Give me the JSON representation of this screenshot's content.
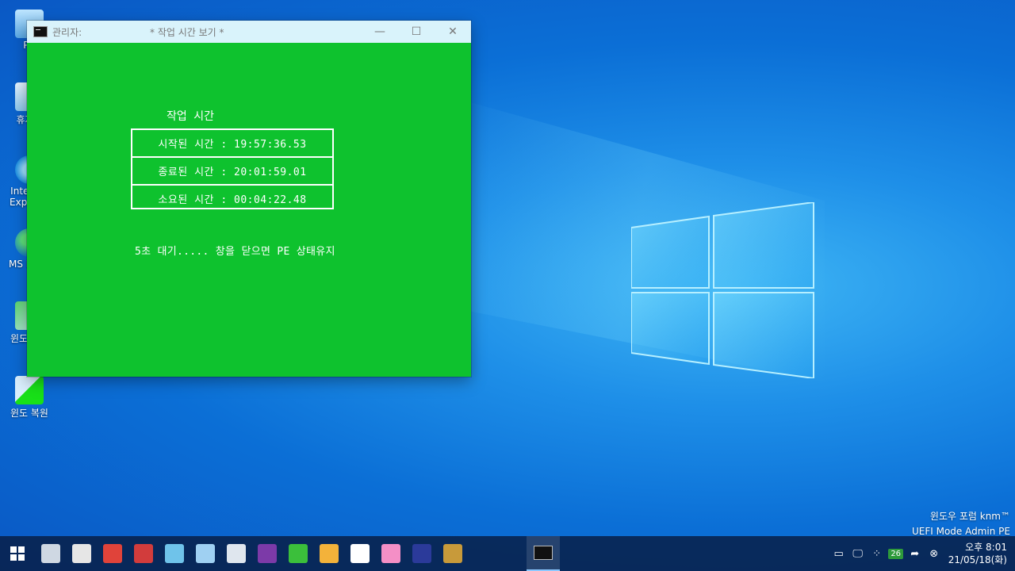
{
  "desktop": {
    "icons": [
      {
        "label": "PC"
      },
      {
        "label": "휴지통"
      },
      {
        "label": "Internet Explorer"
      },
      {
        "label": "MS Edge"
      },
      {
        "label": "윈도 백업"
      },
      {
        "label": "윈도 복원"
      }
    ],
    "watermark": {
      "line1": "윈도우 포럼 knm™",
      "line2": "UEFI Mode Admin PE"
    }
  },
  "window": {
    "title_prefix": "관리자:",
    "title": "* 작업 시간 보기 *",
    "minimize": "—",
    "maximize": "☐",
    "close": "✕"
  },
  "console": {
    "heading": "작업 시간",
    "rows": [
      {
        "text": "시작된 시간 : 19:57:36.53"
      },
      {
        "text": "종료된 시간 : 20:01:59.01"
      },
      {
        "text": "소요된 시간 : 00:04:22.48"
      }
    ],
    "message": "5초 대기.....  창을 닫으면 PE 상태유지"
  },
  "taskbar": {
    "pinned": [
      {
        "name": "system-info-icon",
        "color": "#cfd8e3"
      },
      {
        "name": "disk-tool-icon",
        "color": "#e6e6e6"
      },
      {
        "name": "partition-icon",
        "color": "#e0433a"
      },
      {
        "name": "backup-drive-icon",
        "color": "#d23c3c"
      },
      {
        "name": "file-explorer-icon",
        "color": "#6fc3ea"
      },
      {
        "name": "remote-desktop-icon",
        "color": "#9fd0f2"
      },
      {
        "name": "tools-icon",
        "color": "#dfe6ee"
      },
      {
        "name": "media-player-icon",
        "color": "#7c3aa8"
      },
      {
        "name": "sync-icon",
        "color": "#3bbf3b"
      },
      {
        "name": "network-share-icon",
        "color": "#f3b23a"
      },
      {
        "name": "security-shield-icon",
        "color": "#ffffff"
      },
      {
        "name": "windows-store-icon",
        "color": "#f48fc6"
      },
      {
        "name": "phone-icon",
        "color": "#2b3a9a"
      },
      {
        "name": "memory-card-icon",
        "color": "#c89a3a"
      }
    ],
    "tray": {
      "badge": "26",
      "time": "오후 8:01",
      "date": "21/05/18(화)"
    }
  }
}
